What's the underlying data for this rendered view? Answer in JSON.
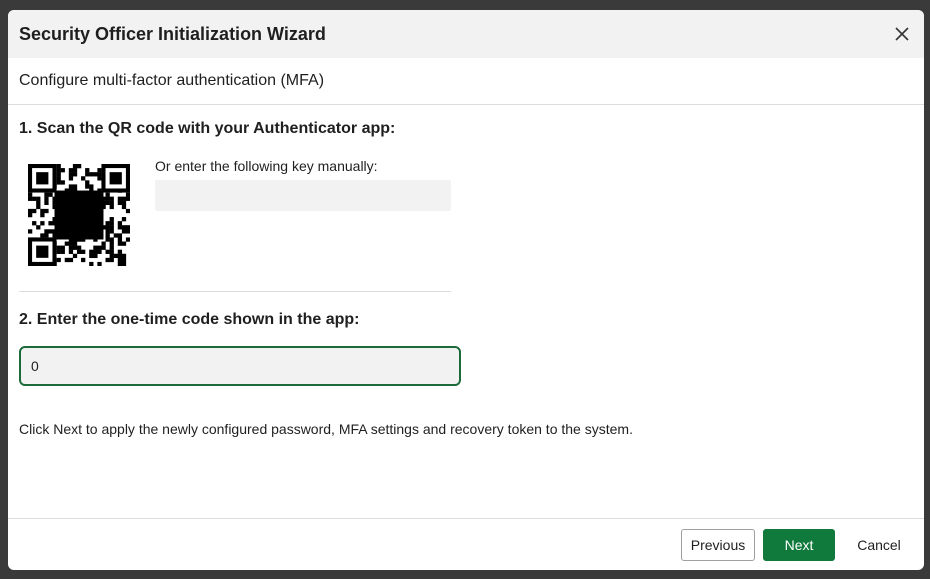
{
  "dialog": {
    "title": "Security Officer Initialization Wizard",
    "close_icon": "close-icon",
    "step_title": "Configure multi-factor authentication (MFA)"
  },
  "qr_section": {
    "heading": "1. Scan the QR code with your Authenticator app:",
    "manual_key_label": "Or enter the following key manually:",
    "manual_key_value": ""
  },
  "code_section": {
    "heading": "2. Enter the one-time code shown in the app:",
    "code_value": "0"
  },
  "info_text": "Click Next to apply the newly configured password, MFA settings and recovery token to the system.",
  "footer": {
    "previous_label": "Previous",
    "next_label": "Next",
    "cancel_label": "Cancel"
  },
  "colors": {
    "accent": "#107a3c",
    "input_border": "#1a6b38",
    "header_bg": "#f2f2f2"
  }
}
